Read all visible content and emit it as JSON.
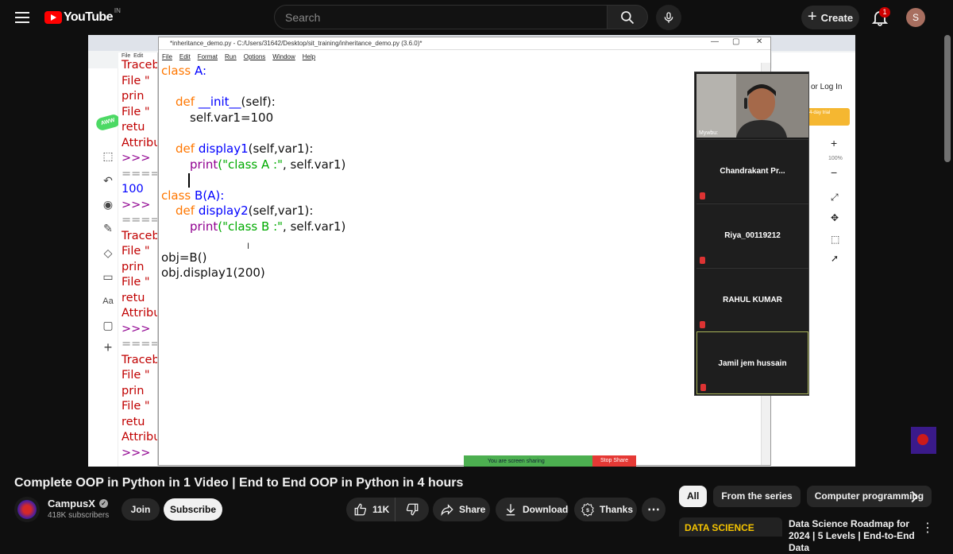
{
  "header": {
    "logo_text": "YouTube",
    "country": "IN",
    "search_placeholder": "Search",
    "create_label": "Create",
    "notifications_count": "1",
    "avatar_letter": "S"
  },
  "player": {
    "editor_title": "*inheritance_demo.py - C:/Users/31642/Desktop/sit_training/inheritance_demo.py (3.6.0)*",
    "editor_menu": [
      "File",
      "Edit",
      "Format",
      "Run",
      "Options",
      "Window",
      "Help"
    ],
    "shell_menu": [
      "File",
      "Edit"
    ],
    "shell_lines": [
      {
        "text": "Traceb",
        "color": "#c00000"
      },
      {
        "text": "  File \"",
        "color": "#c00000"
      },
      {
        "text": "    prin",
        "color": "#c00000"
      },
      {
        "text": "  File \"",
        "color": "#c00000"
      },
      {
        "text": "    retu",
        "color": "#c00000"
      },
      {
        "text": "Attribu",
        "color": "#c00000"
      },
      {
        "text": ">>>",
        "color": "#900090"
      },
      {
        "text": "=====",
        "color": "#888888"
      },
      {
        "text": "100",
        "color": "#0000ff"
      },
      {
        "text": ">>>",
        "color": "#900090"
      },
      {
        "text": "=====",
        "color": "#888888"
      },
      {
        "text": "Traceb",
        "color": "#c00000"
      },
      {
        "text": "  File \"",
        "color": "#c00000"
      },
      {
        "text": "    prin",
        "color": "#c00000"
      },
      {
        "text": "  File \"",
        "color": "#c00000"
      },
      {
        "text": "    retu",
        "color": "#c00000"
      },
      {
        "text": "Attribu",
        "color": "#c00000"
      },
      {
        "text": ">>>",
        "color": "#900090"
      },
      {
        "text": "=====",
        "color": "#888888"
      },
      {
        "text": "Traceb",
        "color": "#c00000"
      },
      {
        "text": "  File \"",
        "color": "#c00000"
      },
      {
        "text": "    prin",
        "color": "#c00000"
      },
      {
        "text": "  File \"",
        "color": "#c00000"
      },
      {
        "text": "    retu",
        "color": "#c00000"
      },
      {
        "text": "Attribu",
        "color": "#c00000"
      },
      {
        "text": ">>>",
        "color": "#900090"
      }
    ],
    "code": {
      "l1_kw": "class",
      "l1_name": "A:",
      "l2_kw": "def",
      "l2_name": "__init__",
      "l2_rest": "(self):",
      "l3": "self.var1=100",
      "l4_kw": "def",
      "l4_name": "display1",
      "l4_rest": "(self,var1):",
      "l5_bi": "print",
      "l5_str": "(\"class A :\"",
      "l5_rest": ", self.var1)",
      "l6_kw": "class",
      "l6_name": "B(A):",
      "l7_kw": "def",
      "l7_name": "display2",
      "l7_rest": "(self,var1):",
      "l8_bi": "print",
      "l8_str": "(\"class B :\"",
      "l8_rest": ", self.var1)",
      "l9": "obj=B()",
      "l10": "obj.display1(200)"
    },
    "right_panel": {
      "login": "or Log In",
      "trial": "4-day trial",
      "zoom": "100%"
    },
    "participants": {
      "cam_label": "Mywbu:",
      "names": [
        "Chandrakant Pr...",
        "Riya_00119212",
        "RAHUL KUMAR",
        "Jamil jem hussain"
      ]
    },
    "share_bar": {
      "text": "You are screen sharing",
      "stop": "Stop Share"
    }
  },
  "video": {
    "title": "Complete OOP in Python in 1 Video | End to End OOP in Python in 4 hours",
    "channel": "CampusX",
    "subscribers": "418K subscribers",
    "join_label": "Join",
    "subscribe_label": "Subscribe",
    "likes": "11K",
    "share_label": "Share",
    "download_label": "Download",
    "thanks_label": "Thanks"
  },
  "sidebar": {
    "chips": [
      "All",
      "From the series",
      "Computer programming"
    ],
    "rec_thumb_label": "DATA SCIENCE",
    "rec_title": "Data Science Roadmap for 2024 | 5 Levels | End-to-End Data"
  }
}
